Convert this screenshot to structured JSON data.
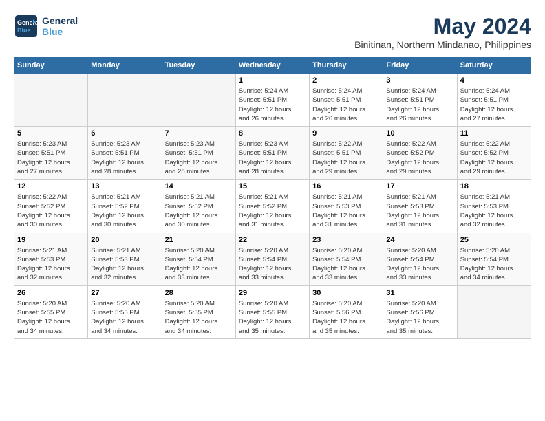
{
  "header": {
    "logo_line1": "General",
    "logo_line2": "Blue",
    "month": "May 2024",
    "location": "Binitinan, Northern Mindanao, Philippines"
  },
  "weekdays": [
    "Sunday",
    "Monday",
    "Tuesday",
    "Wednesday",
    "Thursday",
    "Friday",
    "Saturday"
  ],
  "weeks": [
    [
      {
        "day": "",
        "info": ""
      },
      {
        "day": "",
        "info": ""
      },
      {
        "day": "",
        "info": ""
      },
      {
        "day": "1",
        "info": "Sunrise: 5:24 AM\nSunset: 5:51 PM\nDaylight: 12 hours\nand 26 minutes."
      },
      {
        "day": "2",
        "info": "Sunrise: 5:24 AM\nSunset: 5:51 PM\nDaylight: 12 hours\nand 26 minutes."
      },
      {
        "day": "3",
        "info": "Sunrise: 5:24 AM\nSunset: 5:51 PM\nDaylight: 12 hours\nand 26 minutes."
      },
      {
        "day": "4",
        "info": "Sunrise: 5:24 AM\nSunset: 5:51 PM\nDaylight: 12 hours\nand 27 minutes."
      }
    ],
    [
      {
        "day": "5",
        "info": "Sunrise: 5:23 AM\nSunset: 5:51 PM\nDaylight: 12 hours\nand 27 minutes."
      },
      {
        "day": "6",
        "info": "Sunrise: 5:23 AM\nSunset: 5:51 PM\nDaylight: 12 hours\nand 28 minutes."
      },
      {
        "day": "7",
        "info": "Sunrise: 5:23 AM\nSunset: 5:51 PM\nDaylight: 12 hours\nand 28 minutes."
      },
      {
        "day": "8",
        "info": "Sunrise: 5:23 AM\nSunset: 5:51 PM\nDaylight: 12 hours\nand 28 minutes."
      },
      {
        "day": "9",
        "info": "Sunrise: 5:22 AM\nSunset: 5:51 PM\nDaylight: 12 hours\nand 29 minutes."
      },
      {
        "day": "10",
        "info": "Sunrise: 5:22 AM\nSunset: 5:52 PM\nDaylight: 12 hours\nand 29 minutes."
      },
      {
        "day": "11",
        "info": "Sunrise: 5:22 AM\nSunset: 5:52 PM\nDaylight: 12 hours\nand 29 minutes."
      }
    ],
    [
      {
        "day": "12",
        "info": "Sunrise: 5:22 AM\nSunset: 5:52 PM\nDaylight: 12 hours\nand 30 minutes."
      },
      {
        "day": "13",
        "info": "Sunrise: 5:21 AM\nSunset: 5:52 PM\nDaylight: 12 hours\nand 30 minutes."
      },
      {
        "day": "14",
        "info": "Sunrise: 5:21 AM\nSunset: 5:52 PM\nDaylight: 12 hours\nand 30 minutes."
      },
      {
        "day": "15",
        "info": "Sunrise: 5:21 AM\nSunset: 5:52 PM\nDaylight: 12 hours\nand 31 minutes."
      },
      {
        "day": "16",
        "info": "Sunrise: 5:21 AM\nSunset: 5:53 PM\nDaylight: 12 hours\nand 31 minutes."
      },
      {
        "day": "17",
        "info": "Sunrise: 5:21 AM\nSunset: 5:53 PM\nDaylight: 12 hours\nand 31 minutes."
      },
      {
        "day": "18",
        "info": "Sunrise: 5:21 AM\nSunset: 5:53 PM\nDaylight: 12 hours\nand 32 minutes."
      }
    ],
    [
      {
        "day": "19",
        "info": "Sunrise: 5:21 AM\nSunset: 5:53 PM\nDaylight: 12 hours\nand 32 minutes."
      },
      {
        "day": "20",
        "info": "Sunrise: 5:21 AM\nSunset: 5:53 PM\nDaylight: 12 hours\nand 32 minutes."
      },
      {
        "day": "21",
        "info": "Sunrise: 5:20 AM\nSunset: 5:54 PM\nDaylight: 12 hours\nand 33 minutes."
      },
      {
        "day": "22",
        "info": "Sunrise: 5:20 AM\nSunset: 5:54 PM\nDaylight: 12 hours\nand 33 minutes."
      },
      {
        "day": "23",
        "info": "Sunrise: 5:20 AM\nSunset: 5:54 PM\nDaylight: 12 hours\nand 33 minutes."
      },
      {
        "day": "24",
        "info": "Sunrise: 5:20 AM\nSunset: 5:54 PM\nDaylight: 12 hours\nand 33 minutes."
      },
      {
        "day": "25",
        "info": "Sunrise: 5:20 AM\nSunset: 5:54 PM\nDaylight: 12 hours\nand 34 minutes."
      }
    ],
    [
      {
        "day": "26",
        "info": "Sunrise: 5:20 AM\nSunset: 5:55 PM\nDaylight: 12 hours\nand 34 minutes."
      },
      {
        "day": "27",
        "info": "Sunrise: 5:20 AM\nSunset: 5:55 PM\nDaylight: 12 hours\nand 34 minutes."
      },
      {
        "day": "28",
        "info": "Sunrise: 5:20 AM\nSunset: 5:55 PM\nDaylight: 12 hours\nand 34 minutes."
      },
      {
        "day": "29",
        "info": "Sunrise: 5:20 AM\nSunset: 5:55 PM\nDaylight: 12 hours\nand 35 minutes."
      },
      {
        "day": "30",
        "info": "Sunrise: 5:20 AM\nSunset: 5:56 PM\nDaylight: 12 hours\nand 35 minutes."
      },
      {
        "day": "31",
        "info": "Sunrise: 5:20 AM\nSunset: 5:56 PM\nDaylight: 12 hours\nand 35 minutes."
      },
      {
        "day": "",
        "info": ""
      }
    ]
  ]
}
